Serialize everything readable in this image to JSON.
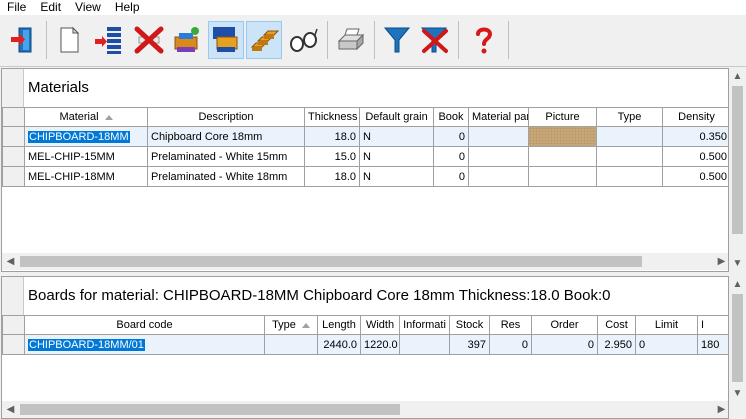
{
  "menu": [
    "File",
    "Edit",
    "View",
    "Help"
  ],
  "toolbar": {
    "buttons": [
      {
        "icon": "exit-door-icon"
      },
      {
        "icon": "new-document-icon"
      },
      {
        "icon": "insert-list-icon"
      },
      {
        "icon": "delete-x-icon"
      },
      {
        "icon": "print-boards-icon"
      },
      {
        "icon": "copy-material-icon",
        "pressed": true
      },
      {
        "icon": "stacked-boards-icon",
        "pressed": true
      },
      {
        "icon": "glasses-view-icon"
      },
      {
        "icon": "printer-icon"
      },
      {
        "icon": "filter-icon"
      },
      {
        "icon": "clear-filter-icon"
      },
      {
        "icon": "help-question-icon"
      }
    ]
  },
  "materials": {
    "title": "Materials",
    "columns": [
      "Material",
      "Description",
      "Thickness",
      "Default grain",
      "Book",
      "Material par",
      "Picture",
      "Type",
      "Density"
    ],
    "rows": [
      {
        "material": "CHIPBOARD-18MM",
        "description": "Chipboard Core 18mm",
        "thickness": "18.0",
        "grain": "N",
        "book": "0",
        "par": "",
        "picture": "wood-texture",
        "type": "",
        "density": "0.350",
        "selected": true
      },
      {
        "material": "MEL-CHIP-15MM",
        "description": "Prelaminated - White 15mm",
        "thickness": "15.0",
        "grain": "N",
        "book": "0",
        "par": "",
        "picture": "",
        "type": "",
        "density": "0.500"
      },
      {
        "material": "MEL-CHIP-18MM",
        "description": "Prelaminated - White 18mm",
        "thickness": "18.0",
        "grain": "N",
        "book": "0",
        "par": "",
        "picture": "",
        "type": "",
        "density": "0.500"
      }
    ]
  },
  "boards": {
    "title": "Boards for material: CHIPBOARD-18MM Chipboard Core 18mm Thickness:18.0 Book:0",
    "columns": [
      "Board code",
      "Type",
      "Length",
      "Width",
      "Informati",
      "Stock",
      "Res",
      "Order",
      "Cost",
      "Limit",
      "I"
    ],
    "rows": [
      {
        "code": "CHIPBOARD-18MM/01",
        "type": "",
        "length": "2440.0",
        "width": "1220.0",
        "info": "",
        "stock": "397",
        "res": "0",
        "order": "0",
        "cost": "2.950",
        "limit": "0",
        "extra": "180",
        "selected": true
      }
    ]
  },
  "colors": {
    "selection": "#0078d7",
    "selected_row": "#eaf3fc",
    "chrome": "#f0f0f0"
  }
}
